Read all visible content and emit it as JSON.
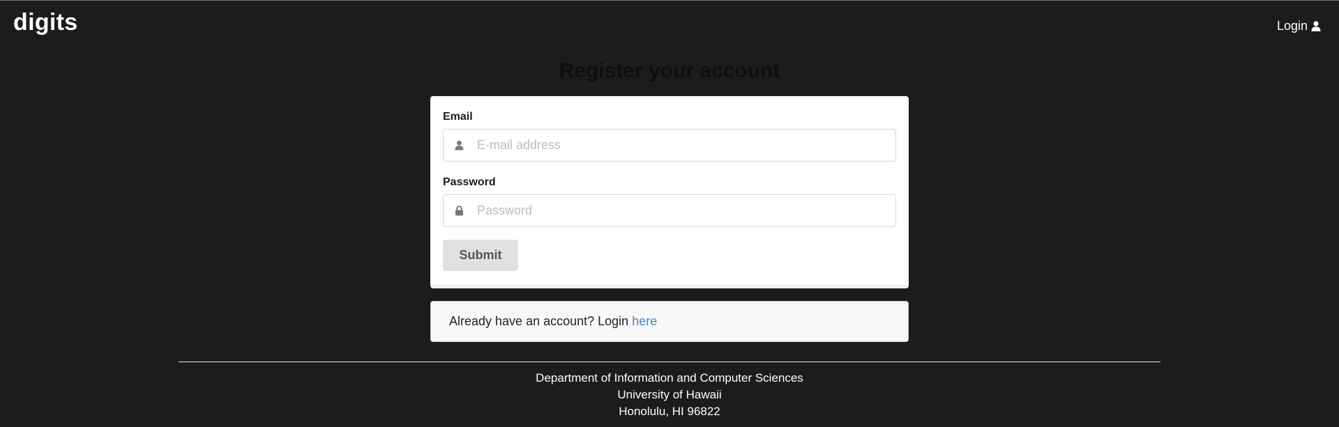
{
  "menu": {
    "brand": "digits",
    "login_label": "Login",
    "login_icon": "user-icon"
  },
  "page": {
    "title": "Register your account"
  },
  "form": {
    "email_label": "Email",
    "email_placeholder": "E-mail address",
    "email_value": "",
    "email_icon": "user-icon",
    "password_label": "Password",
    "password_placeholder": "Password",
    "password_value": "",
    "password_icon": "lock-icon",
    "submit_label": "Submit"
  },
  "message": {
    "text": "Already have an account? Login",
    "link": "here",
    "link_color": "#4183c4"
  },
  "footer": {
    "line1": "Department of Information and Computer Sciences",
    "line2": "University of Hawaii",
    "line3": "Honolulu, HI 96822"
  },
  "colors": {
    "background": "#1b1c1d",
    "button": "#e0e1e2"
  }
}
